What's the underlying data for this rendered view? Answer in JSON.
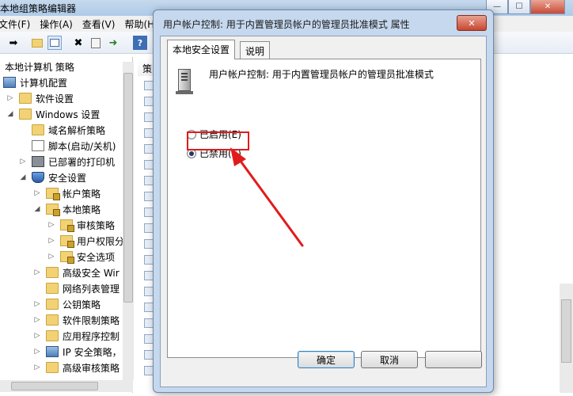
{
  "window": {
    "title": "本地组策略编辑器",
    "menu": [
      "文件(F)",
      "操作(A)",
      "查看(V)",
      "帮助(H)"
    ],
    "controls": {
      "minimize": "—",
      "maximize": "☐",
      "close": "✕"
    }
  },
  "tree": {
    "root": "本地计算机 策略",
    "items": [
      {
        "label": "计算机配置"
      },
      {
        "label": "软件设置"
      },
      {
        "label": "Windows 设置"
      },
      {
        "label": "域名解析策略"
      },
      {
        "label": "脚本(启动/关机)"
      },
      {
        "label": "已部署的打印机"
      },
      {
        "label": "安全设置"
      },
      {
        "label": "帐户策略"
      },
      {
        "label": "本地策略"
      },
      {
        "label": "审核策略"
      },
      {
        "label": "用户权限分"
      },
      {
        "label": "安全选项"
      },
      {
        "label": "高级安全 Wir"
      },
      {
        "label": "网络列表管理"
      },
      {
        "label": "公钥策略"
      },
      {
        "label": "软件限制策略"
      },
      {
        "label": "应用程序控制"
      },
      {
        "label": "IP 安全策略，"
      },
      {
        "label": "高级审核策略"
      }
    ]
  },
  "list": {
    "column_header": "策"
  },
  "dialog": {
    "title": "用户帐户控制: 用于内置管理员帐户的管理员批准模式 属性",
    "close_label": "✕",
    "tabs": [
      {
        "label": "本地安全设置",
        "active": true
      },
      {
        "label": "说明",
        "active": false
      }
    ],
    "policy_name": "用户帐户控制: 用于内置管理员帐户的管理员批准模式",
    "options": [
      {
        "label": "已启用(E)",
        "checked": false
      },
      {
        "label": "已禁用(S)",
        "checked": true
      }
    ],
    "buttons": {
      "ok": "确定",
      "cancel": "取消"
    }
  },
  "annotation": {
    "color": "#e11b1b"
  }
}
